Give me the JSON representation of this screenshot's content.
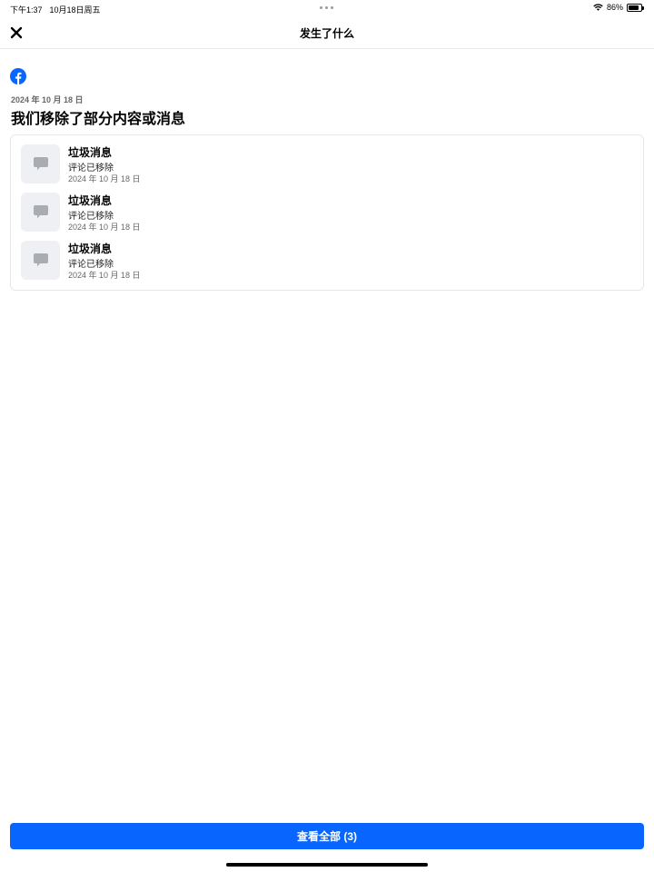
{
  "status_bar": {
    "time": "下午1:37",
    "date": "10月18日周五",
    "battery": "86%",
    "battery_level": 0.86
  },
  "header": {
    "title": "发生了什么",
    "close_icon": "close-icon"
  },
  "notice": {
    "logo_icon": "facebook-logo-icon",
    "date": "2024 年 10 月 18 日",
    "headline": "我们移除了部分内容或消息"
  },
  "items": [
    {
      "icon": "comment-icon",
      "title": "垃圾消息",
      "status": "评论已移除",
      "date": "2024 年 10 月 18 日"
    },
    {
      "icon": "comment-icon",
      "title": "垃圾消息",
      "status": "评论已移除",
      "date": "2024 年 10 月 18 日"
    },
    {
      "icon": "comment-icon",
      "title": "垃圾消息",
      "status": "评论已移除",
      "date": "2024 年 10 月 18 日"
    }
  ],
  "footer": {
    "view_all_label": "查看全部 (3)"
  },
  "colors": {
    "accent": "#0866ff",
    "facebook_blue": "#0866ff",
    "thumb_bg": "#eef0f3",
    "secondary_text": "#65676b"
  }
}
